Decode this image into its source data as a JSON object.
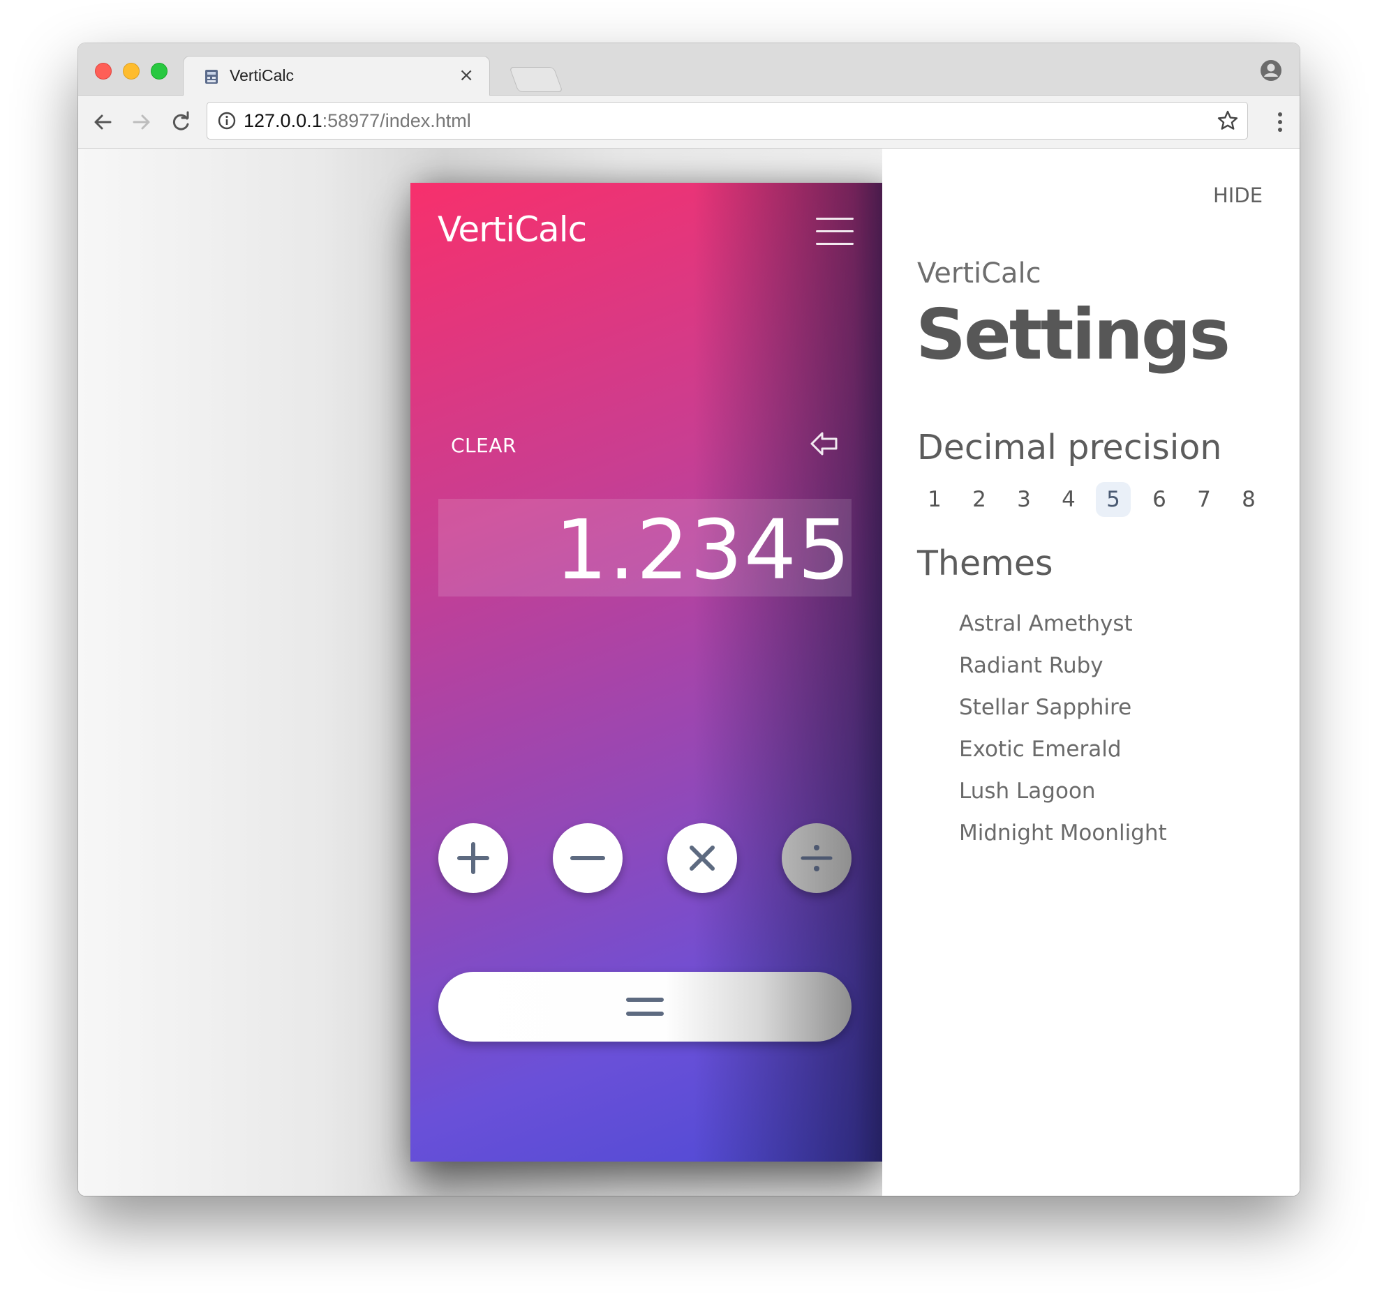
{
  "browser": {
    "tab_title": "VertiCalc",
    "tab_close": "×",
    "url_host": "127.0.0.1",
    "url_path": ":58977/index.html"
  },
  "calculator": {
    "title": "VertiCalc",
    "clear_label": "CLEAR",
    "display_value": "1.2345",
    "operators": [
      {
        "name": "plus-icon"
      },
      {
        "name": "minus-icon"
      },
      {
        "name": "times-icon"
      },
      {
        "name": "divide-icon"
      }
    ],
    "equals": {
      "name": "equals-icon"
    },
    "gradient_colors": [
      "#f7306c",
      "#c83e92",
      "#9448b6",
      "#6a50d8",
      "#4d4ad4"
    ]
  },
  "settings": {
    "hide_label": "HIDE",
    "app_name": "VertiCalc",
    "title": "Settings",
    "precision_heading": "Decimal precision",
    "precision_options": [
      "1",
      "2",
      "3",
      "4",
      "5",
      "6",
      "7",
      "8"
    ],
    "precision_selected": "5",
    "themes_heading": "Themes",
    "themes": [
      "Astral Amethyst",
      "Radiant Ruby",
      "Stellar Sapphire",
      "Exotic Emerald",
      "Lush Lagoon",
      "Midnight Moonlight"
    ]
  },
  "icons": [
    "favicon-icon",
    "close-icon",
    "profile-icon",
    "back-icon",
    "forward-icon",
    "reload-icon",
    "info-icon",
    "star-icon",
    "menu-dots-icon",
    "hamburger-icon",
    "backspace-icon",
    "plus-icon",
    "minus-icon",
    "times-icon",
    "divide-icon",
    "equals-icon"
  ]
}
